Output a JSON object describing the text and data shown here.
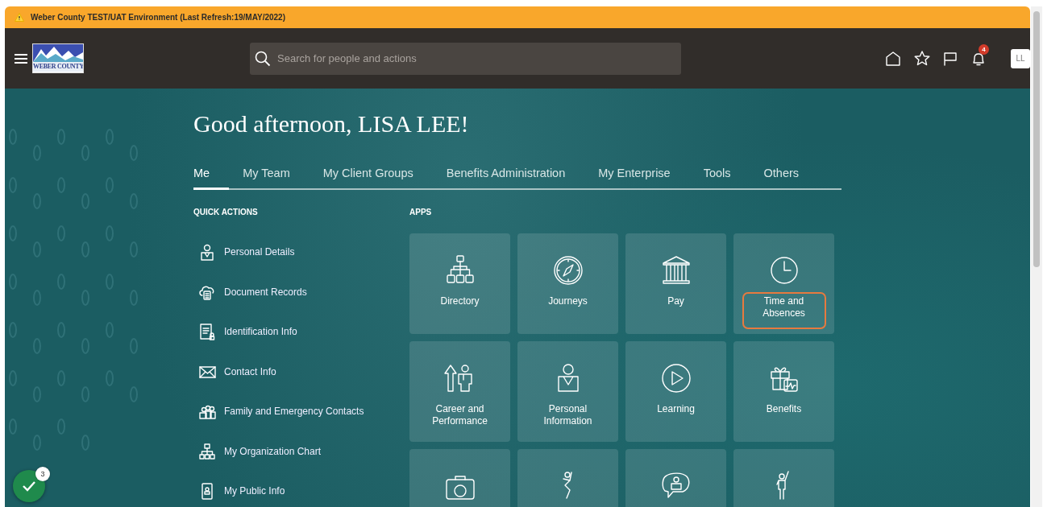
{
  "banner": {
    "text": "Weber County TEST/UAT Environment (Last Refresh:19/MAY/2022)"
  },
  "header": {
    "logo_text": "WEBER COUNTY",
    "search": {
      "placeholder": "Search for people and actions"
    },
    "notifications_count": "4",
    "avatar": "LL"
  },
  "greeting": "Good afternoon, LISA LEE!",
  "tabs": [
    {
      "label": "Me",
      "selected": true
    },
    {
      "label": "My Team",
      "selected": false
    },
    {
      "label": "My Client Groups",
      "selected": false
    },
    {
      "label": "Benefits Administration",
      "selected": false
    },
    {
      "label": "My Enterprise",
      "selected": false
    },
    {
      "label": "Tools",
      "selected": false
    },
    {
      "label": "Others",
      "selected": false
    }
  ],
  "quick_actions": {
    "title": "QUICK ACTIONS",
    "items": [
      "Personal Details",
      "Document Records",
      "Identification Info",
      "Contact Info",
      "Family and Emergency Contacts",
      "My Organization Chart",
      "My Public Info"
    ]
  },
  "apps": {
    "title": "APPS",
    "tiles": [
      {
        "kind": "labeled",
        "label": "Directory",
        "highlighted": false
      },
      {
        "kind": "labeled",
        "label": "Journeys",
        "highlighted": false
      },
      {
        "kind": "labeled",
        "label": "Pay",
        "highlighted": false
      },
      {
        "kind": "labeled",
        "label": "Time and Absences",
        "highlighted": true
      },
      {
        "kind": "labeled",
        "label": "Career and Performance",
        "highlighted": false
      },
      {
        "kind": "labeled",
        "label": "Personal Information",
        "highlighted": false
      },
      {
        "kind": "labeled",
        "label": "Learning",
        "highlighted": false
      },
      {
        "kind": "labeled",
        "label": "Benefits",
        "highlighted": false
      },
      {
        "kind": "icon_only"
      },
      {
        "kind": "icon_only"
      },
      {
        "kind": "icon_only"
      },
      {
        "kind": "icon_only"
      }
    ]
  },
  "guide_button": {
    "count": "3"
  }
}
